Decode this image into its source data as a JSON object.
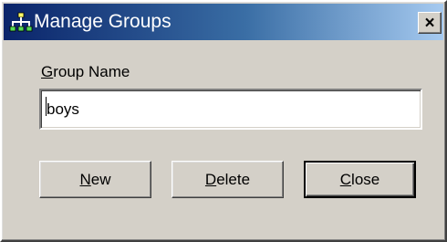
{
  "window": {
    "title": "Manage Groups",
    "icon": "group-tree-icon",
    "close_glyph": "×"
  },
  "form": {
    "group_label_mnemonic": "G",
    "group_label_rest": "roup Name",
    "group_name_value": "boys"
  },
  "buttons": {
    "new_mnemonic": "N",
    "new_rest": "ew",
    "delete_mnemonic": "D",
    "delete_rest": "elete",
    "close_mnemonic": "C",
    "close_rest": "lose"
  },
  "colors": {
    "titlebar_start": "#0a246a",
    "titlebar_end": "#a6caf0",
    "face": "#d4d0c8"
  }
}
